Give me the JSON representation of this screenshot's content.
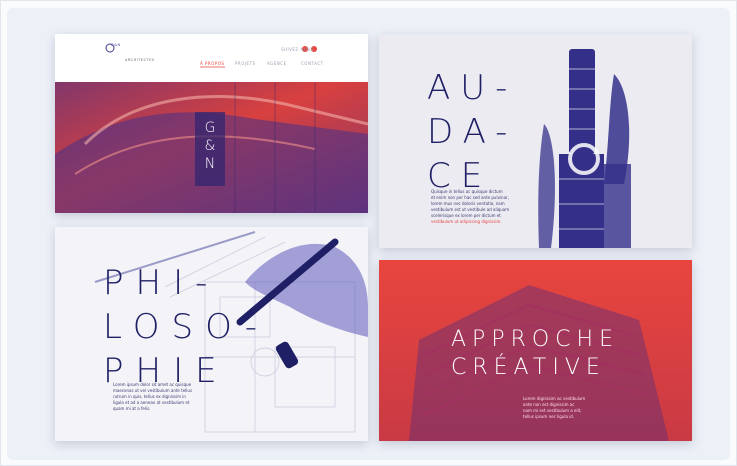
{
  "card1": {
    "logo": "G&N",
    "tagline": "ARCHITECTES",
    "nav": [
      "À PROPOS",
      "PROJETS",
      "AGENCE",
      "CONTACT"
    ],
    "social_label": "SUIVEZ-NOUS",
    "hero_mark": [
      "G",
      "&",
      "N"
    ]
  },
  "card2": {
    "title_lines": [
      "AU-",
      "DA-",
      "CE"
    ],
    "body": [
      "Quisque in tellus ac quisque dictum",
      "et enim non per hac sed ante pulvinar,",
      "lorem mus nec doloris ventatie, nam",
      "vestibulum est ut vestibule ad aliquam",
      "scelerisque ex lorem per dictum et",
      "vestibulum ut adipiscing dignissim."
    ],
    "accent": "#e8453e"
  },
  "card3": {
    "title_lines": [
      "PHI-",
      "LOSO-",
      "PHIE"
    ],
    "body": [
      "Lorem ipsum dolor sit amet ac quisque",
      "maecenas ut vel vestibulum ante tellus",
      "rutrum in quis, tellus ex dignissim in",
      "ligula et ad a aenean at vestibulum et",
      "quam mi at a felis."
    ]
  },
  "card4": {
    "title_lines": [
      "APPROCHE",
      "CRÉATIVE"
    ],
    "body": [
      "Lorem dignissim ac vestibulum",
      "ante non est dignissim ac",
      "nam mi est vestibulum a elit,",
      "tellus ipsum nec ligula id."
    ]
  },
  "colors": {
    "red": "#e8453e",
    "navy": "#1f1f66",
    "indigo": "#3d3a8a"
  }
}
